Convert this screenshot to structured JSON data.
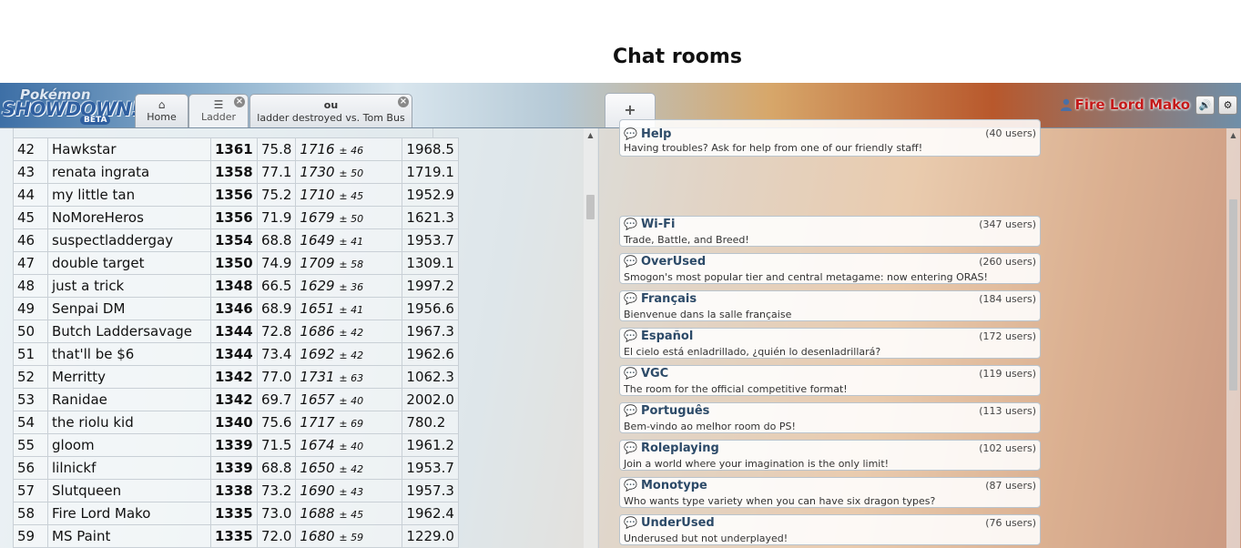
{
  "header": {
    "logo": {
      "top_text": "Pokémon",
      "main_text": "SHOWDOWN!",
      "badge": "BETA"
    },
    "tabs": [
      {
        "icon": "home-icon",
        "label": "Home"
      },
      {
        "icon": "list-icon",
        "label": "Ladder",
        "close": "×"
      },
      {
        "format": "ou",
        "label": "ladder destroyed vs. Tom Bus",
        "close": "×"
      }
    ],
    "new_tab_label": "+",
    "user": {
      "name": "Fire Lord Mako",
      "sound_icon": "🔊",
      "settings_icon": "⚙"
    }
  },
  "ladder": {
    "rows": [
      {
        "rank": "42",
        "name": "Hawkstar",
        "elo": "1361",
        "gxe": "75.8",
        "glicko": "1716",
        "dev": "± 46",
        "coil": "1968.5"
      },
      {
        "rank": "43",
        "name": "renata ingrata",
        "elo": "1358",
        "gxe": "77.1",
        "glicko": "1730",
        "dev": "± 50",
        "coil": "1719.1"
      },
      {
        "rank": "44",
        "name": "my little tan",
        "elo": "1356",
        "gxe": "75.2",
        "glicko": "1710",
        "dev": "± 45",
        "coil": "1952.9"
      },
      {
        "rank": "45",
        "name": "NoMoreHeros",
        "elo": "1356",
        "gxe": "71.9",
        "glicko": "1679",
        "dev": "± 50",
        "coil": "1621.3"
      },
      {
        "rank": "46",
        "name": "suspectladdergay",
        "elo": "1354",
        "gxe": "68.8",
        "glicko": "1649",
        "dev": "± 41",
        "coil": "1953.7"
      },
      {
        "rank": "47",
        "name": "double target",
        "elo": "1350",
        "gxe": "74.9",
        "glicko": "1709",
        "dev": "± 58",
        "coil": "1309.1"
      },
      {
        "rank": "48",
        "name": "just a trick",
        "elo": "1348",
        "gxe": "66.5",
        "glicko": "1629",
        "dev": "± 36",
        "coil": "1997.2"
      },
      {
        "rank": "49",
        "name": "Senpai DM",
        "elo": "1346",
        "gxe": "68.9",
        "glicko": "1651",
        "dev": "± 41",
        "coil": "1956.6"
      },
      {
        "rank": "50",
        "name": "Butch Laddersavage",
        "elo": "1344",
        "gxe": "72.8",
        "glicko": "1686",
        "dev": "± 42",
        "coil": "1967.3"
      },
      {
        "rank": "51",
        "name": "that'll be $6",
        "elo": "1344",
        "gxe": "73.4",
        "glicko": "1692",
        "dev": "± 42",
        "coil": "1962.6"
      },
      {
        "rank": "52",
        "name": "Merritty",
        "elo": "1342",
        "gxe": "77.0",
        "glicko": "1731",
        "dev": "± 63",
        "coil": "1062.3"
      },
      {
        "rank": "53",
        "name": "Ranidae",
        "elo": "1342",
        "gxe": "69.7",
        "glicko": "1657",
        "dev": "± 40",
        "coil": "2002.0"
      },
      {
        "rank": "54",
        "name": "the riolu kid",
        "elo": "1340",
        "gxe": "75.6",
        "glicko": "1717",
        "dev": "± 69",
        "coil": "780.2"
      },
      {
        "rank": "55",
        "name": "gloom",
        "elo": "1339",
        "gxe": "71.5",
        "glicko": "1674",
        "dev": "± 40",
        "coil": "1961.2"
      },
      {
        "rank": "56",
        "name": "lilnickf",
        "elo": "1339",
        "gxe": "68.8",
        "glicko": "1650",
        "dev": "± 42",
        "coil": "1953.7"
      },
      {
        "rank": "57",
        "name": "Slutqueen",
        "elo": "1338",
        "gxe": "73.2",
        "glicko": "1690",
        "dev": "± 43",
        "coil": "1957.3"
      },
      {
        "rank": "58",
        "name": "Fire Lord Mako",
        "elo": "1335",
        "gxe": "73.0",
        "glicko": "1688",
        "dev": "± 45",
        "coil": "1962.4"
      },
      {
        "rank": "59",
        "name": "MS Paint",
        "elo": "1335",
        "gxe": "72.0",
        "glicko": "1680",
        "dev": "± 59",
        "coil": "1229.0"
      }
    ]
  },
  "rooms": {
    "help_partial": {
      "name": "Help",
      "users": "(40 users)",
      "desc": "Having troubles? Ask for help from one of our friendly staff!"
    },
    "heading": "Chat rooms",
    "list": [
      {
        "name": "Wi-Fi",
        "users": "(347 users)",
        "desc": "Trade, Battle, and Breed!"
      },
      {
        "name": "OverUsed",
        "users": "(260 users)",
        "desc": "Smogon's most popular tier and central metagame: now entering ORAS!"
      },
      {
        "name": "Français",
        "users": "(184 users)",
        "desc": "Bienvenue dans la salle française"
      },
      {
        "name": "Español",
        "users": "(172 users)",
        "desc": "El cielo está enladrillado, ¿quién lo desenladrillará?"
      },
      {
        "name": "VGC",
        "users": "(119 users)",
        "desc": "The room for the official competitive format!"
      },
      {
        "name": "Português",
        "users": "(113 users)",
        "desc": "Bem-vindo ao melhor room do PS!"
      },
      {
        "name": "Roleplaying",
        "users": "(102 users)",
        "desc": "Join a world where your imagination is the only limit!"
      },
      {
        "name": "Monotype",
        "users": "(87 users)",
        "desc": "Who wants type variety when you can have six dragon types?"
      },
      {
        "name": "UnderUsed",
        "users": "(76 users)",
        "desc": "Underused but not underplayed!"
      }
    ]
  }
}
